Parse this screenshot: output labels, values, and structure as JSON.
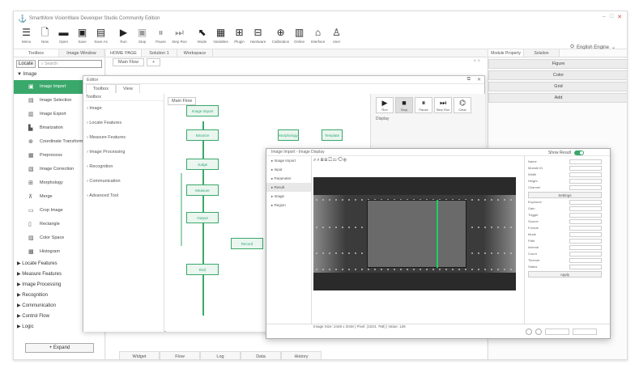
{
  "app": {
    "title": "SmartMore VisionWare Developer Studio Community Edition",
    "brand_color": "#3aa86b"
  },
  "toolbar": {
    "items": [
      {
        "label": "Menu",
        "icon": "menu-icon"
      },
      {
        "label": "New",
        "icon": "new-file-icon"
      },
      {
        "label": "Open",
        "icon": "folder-icon"
      },
      {
        "label": "Save",
        "icon": "save-icon"
      },
      {
        "label": "Save As",
        "icon": "save-as-icon"
      },
      {
        "label": "Run",
        "icon": "play-icon"
      },
      {
        "label": "Stop",
        "icon": "stop-icon"
      },
      {
        "label": "Pause",
        "icon": "pause-icon"
      },
      {
        "label": "Step Run",
        "icon": "step-icon"
      },
      {
        "label": "Mode",
        "icon": "pointer-icon"
      },
      {
        "label": "Variables",
        "icon": "variables-icon"
      },
      {
        "label": "Plugin",
        "icon": "plugin-icon"
      },
      {
        "label": "Hardware",
        "icon": "hardware-icon"
      },
      {
        "label": "Calibration",
        "icon": "calibration-icon"
      },
      {
        "label": "Online",
        "icon": "online-icon"
      },
      {
        "label": "Interface",
        "icon": "interface-icon"
      },
      {
        "label": "User",
        "icon": "user-icon"
      }
    ],
    "language": "English Engine"
  },
  "left_panel": {
    "tabs": [
      "Toolbox",
      "Image Window"
    ],
    "locate_label": "Locate",
    "search_placeholder": "Search",
    "groups": [
      "Image"
    ],
    "items": [
      "Image Import",
      "Image Selection",
      "Image Export",
      "Binarization",
      "Coordinate Transform",
      "Preprocess",
      "Image Correction",
      "Morphology",
      "Merge",
      "Crop Image",
      "Rectangle",
      "Color Space",
      "Histogram"
    ],
    "more_groups": [
      "Locate Features",
      "Measure Features",
      "Image Processing",
      "Recognition",
      "Communication",
      "Control Flow",
      "Logic"
    ],
    "footer_button": "+ Expand"
  },
  "center": {
    "tabs": [
      "HOME PAGE",
      "Solution 1",
      "Workspace"
    ],
    "subtab": "Main Flow",
    "bottom_tabs": [
      "Widget",
      "Flow",
      "Log",
      "Data",
      "History"
    ]
  },
  "dialog": {
    "title": "Editor",
    "tabs": [
      "Toolbox",
      "View"
    ],
    "toolbox_header": "Toolbox",
    "toolbox_rows": [
      "Image",
      "Locate Features",
      "Measure Features",
      "Image Processing",
      "Recognition",
      "Communication",
      "Advanced Tool"
    ],
    "flow_tab": "Main Flow",
    "nodes": [
      "Image Import",
      "Binarize",
      "Morphology",
      "Template",
      "Judge",
      "Measure",
      "Output",
      "Record",
      "End"
    ],
    "run_buttons": [
      "Run",
      "Stop",
      "Pause",
      "Step Run",
      "Clear"
    ],
    "run_caption": "Display"
  },
  "right_panel": {
    "tabs": [
      "Module Property",
      "Solution"
    ],
    "buttons": [
      "Figure",
      "Color",
      "Grid",
      "Add"
    ]
  },
  "image_window": {
    "title": "Image Import - Image Display",
    "toggle_label": "Show Result",
    "tree": [
      "Image Import",
      "Input",
      "Parameter",
      "Result",
      "Image",
      "Region"
    ],
    "tools": "⌕⌕⊞⊟◫▭⟲⊕",
    "status": "Image Size: 2448 x 2048 | Pixel: (1024, 768) | Value: 128",
    "prop_rows": [
      "Name",
      "Module ID",
      "Width",
      "Height",
      "Channel",
      "Exposure",
      "Gain",
      "Trigger",
      "Source",
      "Format",
      "Mode",
      "Path",
      "Interval",
      "Count",
      "Timeout",
      "Status"
    ],
    "prop_buttons": [
      "Settings",
      "Apply"
    ]
  }
}
